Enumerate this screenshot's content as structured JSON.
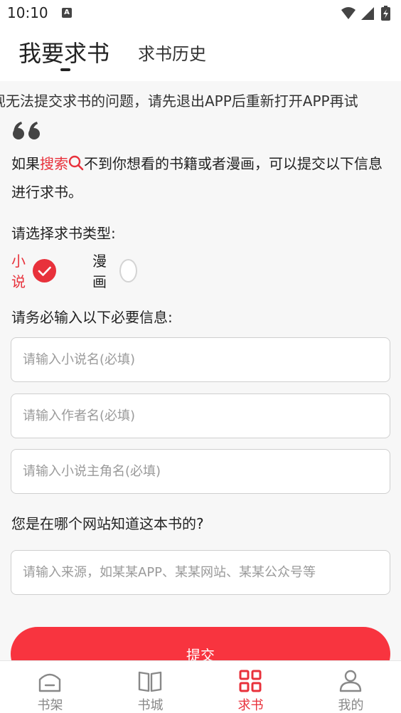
{
  "status_bar": {
    "time": "10:10",
    "notification_badge": "A",
    "icons": [
      "wifi-icon",
      "signal-icon",
      "battery-charging-icon"
    ]
  },
  "top_tabs": {
    "request": "我要求书",
    "history": "求书历史"
  },
  "marquee": {
    "text": "现无法提交求书的问题，请先退出APP后重新打开APP再试"
  },
  "intro": {
    "before": "如果",
    "search_word": "搜索",
    "after": "不到你想看的书籍或者漫画，可以提交以下信息进行求书。"
  },
  "type_section": {
    "label": "请选择求书类型:",
    "options": [
      {
        "label": "小说",
        "selected": true
      },
      {
        "label": "漫画",
        "selected": false
      }
    ]
  },
  "info_section": {
    "label": "请务必输入以下必要信息:",
    "book_name_placeholder": "请输入小说名(必填)",
    "author_placeholder": "请输入作者名(必填)",
    "protagonist_placeholder": "请输入小说主角名(必填)"
  },
  "source_section": {
    "label": "您是在哪个网站知道这本书的?",
    "source_placeholder": "请输入来源，如某某APP、某某网站、某某公众号等"
  },
  "submit_label": "提交",
  "bottom_nav": [
    {
      "label": "书架",
      "icon": "bookshelf-icon",
      "active": false
    },
    {
      "label": "书城",
      "icon": "open-book-icon",
      "active": false
    },
    {
      "label": "求书",
      "icon": "grid-icon",
      "active": true
    },
    {
      "label": "我的",
      "icon": "user-icon",
      "active": false
    }
  ],
  "colors": {
    "accent": "#e8313b",
    "button": "#f8343f",
    "inactive_nav": "#888888"
  }
}
